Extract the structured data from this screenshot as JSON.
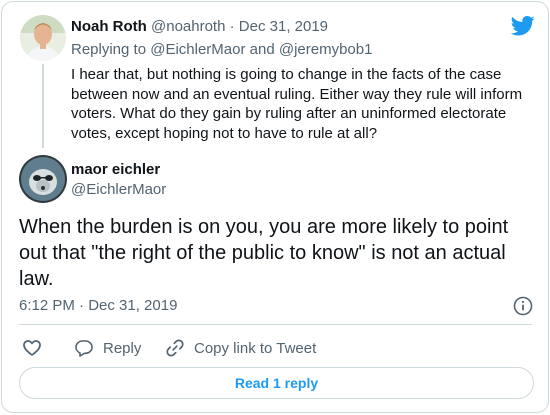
{
  "colors": {
    "brand": "#1d9bf0",
    "text_primary": "#0f1419",
    "text_secondary": "#536471",
    "border": "#cfd9de"
  },
  "icons": {
    "logo": "twitter-bird-icon",
    "info": "info-icon",
    "like": "heart-icon",
    "reply": "reply-bubble-icon",
    "copy_link": "link-icon"
  },
  "parent_tweet": {
    "name": "Noah Roth",
    "handle": "@noahroth",
    "separator": "·",
    "date": "Dec 31, 2019",
    "replying_prefix": "Replying to",
    "replying_to": [
      "@EichlerMaor",
      "@jeremybob1"
    ],
    "replying_joiner": "and",
    "text": "I hear that, but nothing is going to change in the facts of the case between now and an eventual ruling. Either way they rule will inform voters. What do they gain by ruling after an uninformed electorate votes, except hoping not to have to rule at all?"
  },
  "main_tweet": {
    "name": "maor eichler",
    "handle": "@EichlerMaor",
    "text": "When the burden is on you, you are more likely to point out that \"the right of the public to know\" is not an actual law.",
    "time": "6:12 PM · Dec 31, 2019"
  },
  "actions": {
    "reply_label": "Reply",
    "copy_link_label": "Copy link to Tweet"
  },
  "footer": {
    "read_replies_label": "Read 1 reply"
  }
}
